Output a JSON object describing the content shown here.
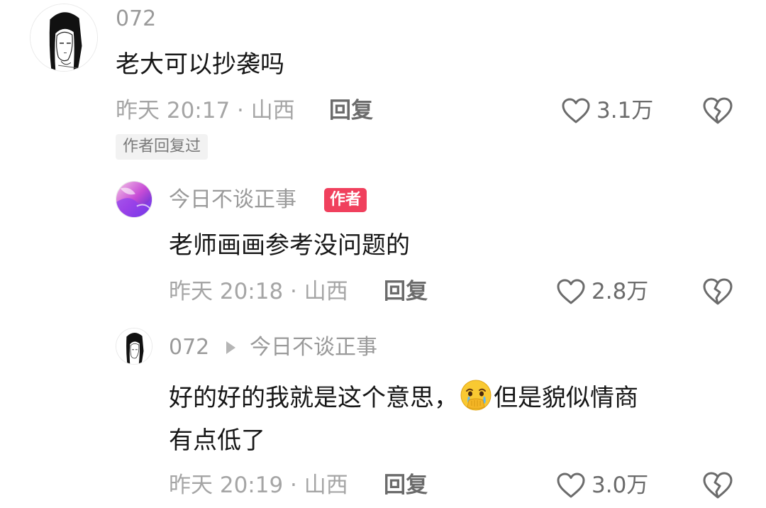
{
  "comments": [
    {
      "username": "072",
      "text": "老大可以抄袭吗",
      "meta": "昨天 20:17 · 山西",
      "reply_label": "回复",
      "likes": "3.1万",
      "author_replied_tag": "作者回复过"
    },
    {
      "username": "今日不谈正事",
      "author_badge": "作者",
      "text": "老师画画参考没问题的",
      "meta": "昨天 20:18 · 山西",
      "reply_label": "回复",
      "likes": "2.8万"
    },
    {
      "username": "072",
      "reply_to": "今日不谈正事",
      "text_line1_before": "好的好的我就是这个意思，",
      "text_line1_after": "但是貌似情商",
      "text_line2": "有点低了",
      "emoji": "crying-face-with-hands-over-mouth",
      "meta": "昨天 20:19 · 山西",
      "reply_label": "回复",
      "likes": "3.0万"
    }
  ],
  "icons": {
    "like": "heart-outline-icon",
    "dislike": "broken-heart-icon"
  },
  "colors": {
    "author_badge": "#f0405d",
    "muted_text": "#a5a5a5",
    "primary_text": "#161616"
  }
}
